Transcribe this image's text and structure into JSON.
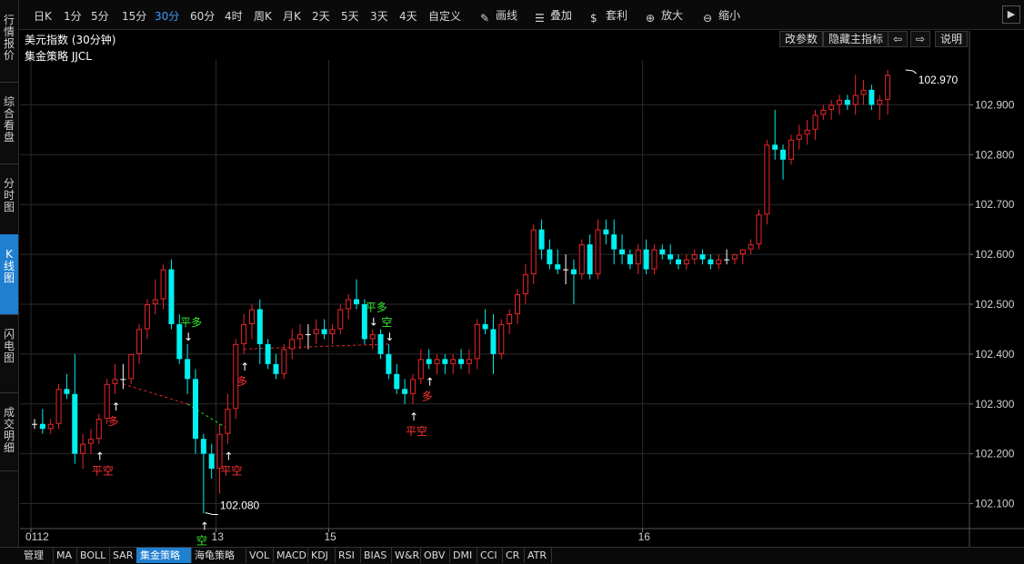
{
  "sidebar": {
    "items": [
      {
        "label": "行情报价",
        "active": false
      },
      {
        "label": "综合看盘",
        "active": false
      },
      {
        "label": "分时图",
        "active": false
      },
      {
        "label": "K线图",
        "active": true
      },
      {
        "label": "闪电图",
        "active": false
      },
      {
        "label": "成交明细",
        "active": false
      }
    ]
  },
  "toolbar": {
    "timeframes": [
      "日K",
      "1分",
      "5分",
      "15分",
      "30分",
      "60分",
      "4时",
      "周K",
      "月K",
      "2天",
      "5天",
      "3天",
      "4天",
      "自定义"
    ],
    "active_timeframe": "30分",
    "tools": [
      {
        "label": "画线",
        "icon": "pencil-icon"
      },
      {
        "label": "叠加",
        "icon": "layers-icon"
      },
      {
        "label": "套利",
        "icon": "money-bag-icon"
      },
      {
        "label": "放大",
        "icon": "zoom-in-icon"
      },
      {
        "label": "缩小",
        "icon": "zoom-out-icon"
      }
    ],
    "expand_icon": "chevron-right-icon"
  },
  "header": {
    "title": "美元指数 (30分钟)",
    "buttons": [
      "改参数",
      "隐藏主指标",
      "⇦",
      "⇨",
      "说明"
    ],
    "strategy": "集金策略 JJCL"
  },
  "bottom_tabs": {
    "items": [
      "管理",
      "MA",
      "BOLL",
      "SAR",
      "集金策略",
      "海龟策略",
      "VOL",
      "MACD",
      "KDJ",
      "RSI",
      "BIAS",
      "W&R",
      "OBV",
      "DMI",
      "CCI",
      "CR",
      "ATR"
    ],
    "active": "集金策略"
  },
  "colors": {
    "up": "#e8262b",
    "down": "#00f0f0",
    "grid": "#2a2a2a",
    "flat": "#ffffff"
  },
  "chart_data": {
    "type": "candlestick",
    "ylim": [
      102.05,
      102.99
    ],
    "y_ticks": [
      "102.900",
      "102.800",
      "102.700",
      "102.600",
      "102.500",
      "102.400",
      "102.300",
      "102.200",
      "102.100"
    ],
    "x_labels": [
      {
        "index": 0,
        "label": "0112"
      },
      {
        "index": 23,
        "label": "13"
      },
      {
        "index": 37,
        "label": "15"
      },
      {
        "index": 76,
        "label": "16"
      }
    ],
    "candles": [
      [
        102.26,
        102.27,
        102.25,
        102.26
      ],
      [
        102.26,
        102.29,
        102.24,
        102.25
      ],
      [
        102.25,
        102.27,
        102.24,
        102.26
      ],
      [
        102.26,
        102.34,
        102.25,
        102.33
      ],
      [
        102.33,
        102.36,
        102.31,
        102.32
      ],
      [
        102.32,
        102.4,
        102.18,
        102.2
      ],
      [
        102.2,
        102.24,
        102.17,
        102.22
      ],
      [
        102.22,
        102.25,
        102.2,
        102.23
      ],
      [
        102.23,
        102.28,
        102.22,
        102.27
      ],
      [
        102.27,
        102.35,
        102.26,
        102.34
      ],
      [
        102.34,
        102.38,
        102.32,
        102.35
      ],
      [
        102.35,
        102.38,
        102.33,
        102.35
      ],
      [
        102.35,
        102.4,
        102.34,
        102.4
      ],
      [
        102.4,
        102.46,
        102.38,
        102.45
      ],
      [
        102.45,
        102.51,
        102.43,
        102.5
      ],
      [
        102.5,
        102.55,
        102.48,
        102.51
      ],
      [
        102.51,
        102.58,
        102.49,
        102.57
      ],
      [
        102.57,
        102.59,
        102.45,
        102.46
      ],
      [
        102.46,
        102.48,
        102.38,
        102.39
      ],
      [
        102.39,
        102.42,
        102.32,
        102.35
      ],
      [
        102.35,
        102.37,
        102.2,
        102.23
      ],
      [
        102.23,
        102.24,
        102.08,
        102.2
      ],
      [
        102.2,
        102.22,
        102.15,
        102.17
      ],
      [
        102.17,
        102.26,
        102.12,
        102.24
      ],
      [
        102.24,
        102.32,
        102.22,
        102.29
      ],
      [
        102.29,
        102.43,
        102.27,
        102.42
      ],
      [
        102.42,
        102.48,
        102.4,
        102.46
      ],
      [
        102.46,
        102.5,
        102.43,
        102.49
      ],
      [
        102.49,
        102.51,
        102.38,
        102.42
      ],
      [
        102.42,
        102.43,
        102.37,
        102.38
      ],
      [
        102.38,
        102.4,
        102.35,
        102.36
      ],
      [
        102.36,
        102.42,
        102.35,
        102.41
      ],
      [
        102.41,
        102.45,
        102.39,
        102.43
      ],
      [
        102.43,
        102.46,
        102.41,
        102.44
      ],
      [
        102.44,
        102.46,
        102.41,
        102.44
      ],
      [
        102.44,
        102.47,
        102.42,
        102.45
      ],
      [
        102.45,
        102.47,
        102.43,
        102.44
      ],
      [
        102.44,
        102.46,
        102.42,
        102.45
      ],
      [
        102.45,
        102.5,
        102.44,
        102.49
      ],
      [
        102.49,
        102.52,
        102.47,
        102.51
      ],
      [
        102.51,
        102.55,
        102.49,
        102.5
      ],
      [
        102.5,
        102.51,
        102.42,
        102.43
      ],
      [
        102.43,
        102.45,
        102.41,
        102.44
      ],
      [
        102.44,
        102.45,
        102.39,
        102.4
      ],
      [
        102.4,
        102.42,
        102.35,
        102.36
      ],
      [
        102.36,
        102.38,
        102.32,
        102.33
      ],
      [
        102.33,
        102.35,
        102.3,
        102.32
      ],
      [
        102.32,
        102.36,
        102.3,
        102.35
      ],
      [
        102.35,
        102.41,
        102.34,
        102.39
      ],
      [
        102.39,
        102.41,
        102.37,
        102.38
      ],
      [
        102.38,
        102.4,
        102.36,
        102.39
      ],
      [
        102.39,
        102.4,
        102.36,
        102.38
      ],
      [
        102.38,
        102.4,
        102.36,
        102.39
      ],
      [
        102.39,
        102.41,
        102.37,
        102.38
      ],
      [
        102.38,
        102.41,
        102.36,
        102.39
      ],
      [
        102.39,
        102.47,
        102.37,
        102.46
      ],
      [
        102.46,
        102.49,
        102.44,
        102.45
      ],
      [
        102.45,
        102.48,
        102.36,
        102.4
      ],
      [
        102.4,
        102.47,
        102.39,
        102.46
      ],
      [
        102.46,
        102.49,
        102.44,
        102.48
      ],
      [
        102.48,
        102.53,
        102.46,
        102.52
      ],
      [
        102.52,
        102.58,
        102.5,
        102.56
      ],
      [
        102.56,
        102.66,
        102.54,
        102.65
      ],
      [
        102.65,
        102.67,
        102.59,
        102.61
      ],
      [
        102.61,
        102.63,
        102.57,
        102.58
      ],
      [
        102.58,
        102.61,
        102.56,
        102.57
      ],
      [
        102.57,
        102.6,
        102.54,
        102.57
      ],
      [
        102.57,
        102.59,
        102.5,
        102.56
      ],
      [
        102.56,
        102.63,
        102.55,
        102.62
      ],
      [
        102.62,
        102.64,
        102.55,
        102.56
      ],
      [
        102.56,
        102.67,
        102.55,
        102.65
      ],
      [
        102.65,
        102.67,
        102.62,
        102.64
      ],
      [
        102.64,
        102.67,
        102.58,
        102.61
      ],
      [
        102.61,
        102.64,
        102.58,
        102.6
      ],
      [
        102.6,
        102.61,
        102.57,
        102.58
      ],
      [
        102.58,
        102.62,
        102.56,
        102.61
      ],
      [
        102.61,
        102.63,
        102.56,
        102.57
      ],
      [
        102.57,
        102.62,
        102.56,
        102.61
      ],
      [
        102.61,
        102.62,
        102.59,
        102.6
      ],
      [
        102.6,
        102.62,
        102.58,
        102.59
      ],
      [
        102.59,
        102.6,
        102.57,
        102.58
      ],
      [
        102.58,
        102.6,
        102.57,
        102.59
      ],
      [
        102.59,
        102.61,
        102.58,
        102.6
      ],
      [
        102.6,
        102.61,
        102.58,
        102.59
      ],
      [
        102.59,
        102.6,
        102.57,
        102.58
      ],
      [
        102.58,
        102.6,
        102.57,
        102.59
      ],
      [
        102.59,
        102.61,
        102.58,
        102.59
      ],
      [
        102.59,
        102.6,
        102.58,
        102.6
      ],
      [
        102.6,
        102.61,
        102.58,
        102.61
      ],
      [
        102.61,
        102.63,
        102.6,
        102.62
      ],
      [
        102.62,
        102.69,
        102.61,
        102.68
      ],
      [
        102.68,
        102.83,
        102.66,
        102.82
      ],
      [
        102.82,
        102.89,
        102.79,
        102.81
      ],
      [
        102.81,
        102.82,
        102.75,
        102.79
      ],
      [
        102.79,
        102.84,
        102.78,
        102.83
      ],
      [
        102.83,
        102.86,
        102.81,
        102.84
      ],
      [
        102.84,
        102.87,
        102.82,
        102.85
      ],
      [
        102.85,
        102.89,
        102.83,
        102.88
      ],
      [
        102.88,
        102.9,
        102.87,
        102.89
      ],
      [
        102.89,
        102.91,
        102.87,
        102.9
      ],
      [
        102.9,
        102.92,
        102.88,
        102.91
      ],
      [
        102.91,
        102.92,
        102.89,
        102.9
      ],
      [
        102.9,
        102.96,
        102.88,
        102.92
      ],
      [
        102.92,
        102.95,
        102.9,
        102.93
      ],
      [
        102.93,
        102.94,
        102.89,
        102.9
      ],
      [
        102.9,
        102.92,
        102.87,
        102.91
      ],
      [
        102.91,
        102.97,
        102.88,
        102.96
      ]
    ],
    "annotations": [
      {
        "index": 21,
        "price": 102.08,
        "label": "102.080",
        "kind": "low"
      },
      {
        "index": 108,
        "price": 102.97,
        "label": "102.970",
        "kind": "high"
      }
    ],
    "signals": [
      {
        "index": 8,
        "text": "平空",
        "color": "red",
        "arrow": "up"
      },
      {
        "index": 10,
        "text": "多",
        "color": "red",
        "arrow": "up"
      },
      {
        "index": 19,
        "text": "平多",
        "color": "green",
        "arrow": "down"
      },
      {
        "index": 21,
        "text": "空",
        "color": "green",
        "arrow": "up"
      },
      {
        "index": 24,
        "text": "平空",
        "color": "red",
        "arrow": "up"
      },
      {
        "index": 26,
        "text": "多",
        "color": "red",
        "arrow": "up"
      },
      {
        "index": 42,
        "text": "平多",
        "color": "green",
        "arrow": "down"
      },
      {
        "index": 44,
        "text": "空",
        "color": "green",
        "arrow": "down"
      },
      {
        "index": 47,
        "text": "平空",
        "color": "red",
        "arrow": "up"
      },
      {
        "index": 49,
        "text": "多",
        "color": "red",
        "arrow": "up"
      }
    ],
    "stop_lines": [
      {
        "from_index": 11,
        "to_index": 19,
        "from_price": 102.34,
        "to_price": 102.3,
        "color": "red"
      },
      {
        "from_index": 19,
        "to_index": 24,
        "from_price": 102.3,
        "to_price": 102.25,
        "color": "green"
      },
      {
        "from_index": 26,
        "to_index": 44,
        "from_price": 102.41,
        "to_price": 102.42,
        "color": "red"
      }
    ]
  }
}
